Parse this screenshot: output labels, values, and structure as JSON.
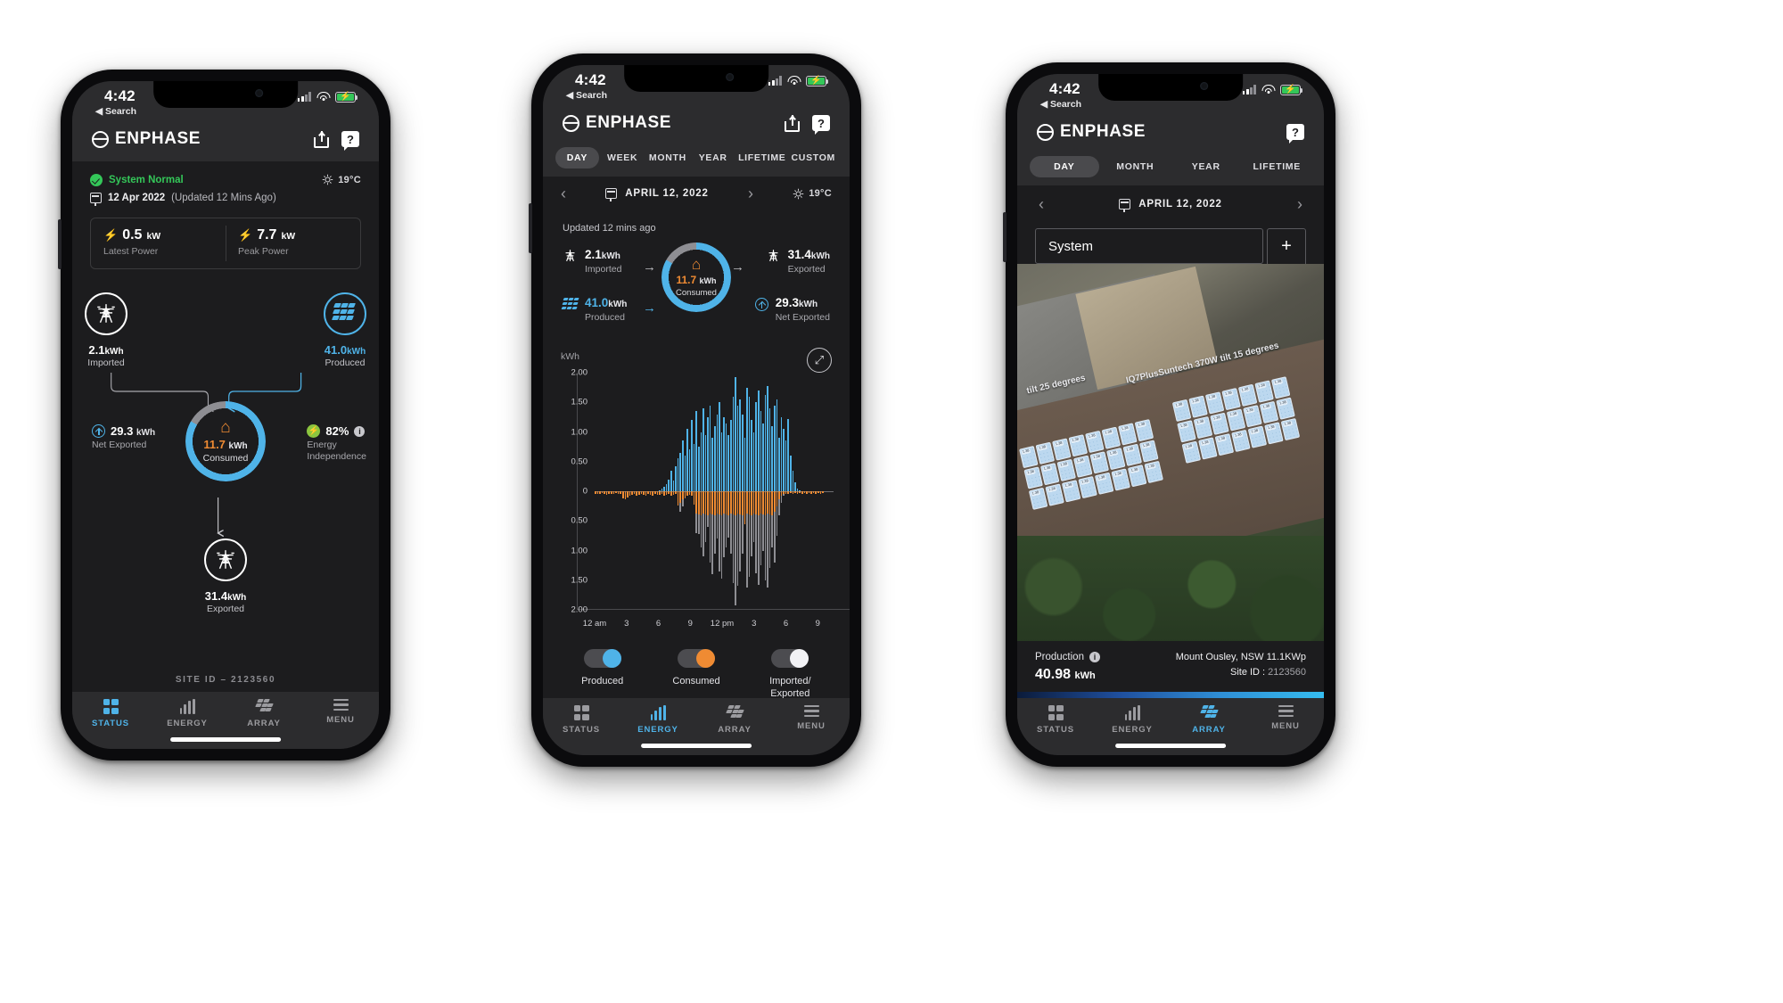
{
  "common": {
    "status_time": "4:42",
    "back_label": "◀ Search",
    "brand": "ENPHASE",
    "help_glyph": "?",
    "nav": [
      {
        "label": "STATUS",
        "icon": "status-grid-icon"
      },
      {
        "label": "ENERGY",
        "icon": "energy-bars-icon"
      },
      {
        "label": "ARRAY",
        "icon": "array-panels-icon"
      },
      {
        "label": "MENU",
        "icon": "hamburger-icon"
      }
    ],
    "colors": {
      "accent_blue": "#4fb3e8",
      "consumed_orange": "#ef8b33",
      "ok_green": "#34c759",
      "eco_green": "#8bc53f",
      "grey_series": "#8e8e93"
    }
  },
  "phone1": {
    "active_tab": "STATUS",
    "system_status": "System Normal",
    "date": "12 Apr 2022",
    "updated": "(Updated 12 Mins Ago)",
    "temperature": "19°C",
    "power": [
      {
        "value": "0.5",
        "unit": "kW",
        "label": "Latest Power"
      },
      {
        "value": "7.7",
        "unit": "kW",
        "label": "Peak Power"
      }
    ],
    "flow": {
      "imported": {
        "value": "2.1",
        "unit": "kWh",
        "label": "Imported"
      },
      "produced": {
        "value": "41.0",
        "unit": "kWh",
        "label": "Produced"
      },
      "consumed": {
        "value": "11.7",
        "unit": "kWh",
        "label": "Consumed"
      },
      "exported": {
        "value": "31.4",
        "unit": "kWh",
        "label": "Exported"
      },
      "net_exported": {
        "value": "29.3",
        "unit": "kWh",
        "label": "Net Exported"
      },
      "energy_independence": {
        "value": "82%",
        "label": "Energy\nIndependence"
      }
    },
    "site_id": "SITE ID – 2123560"
  },
  "phone2": {
    "active_tab": "ENERGY",
    "tabs": [
      "DAY",
      "WEEK",
      "MONTH",
      "YEAR",
      "LIFETIME",
      "CUSTOM"
    ],
    "active_range": "DAY",
    "date": "APRIL 12, 2022",
    "temperature": "19°C",
    "updated": "Updated 12 mins ago",
    "summary": {
      "imported": {
        "value": "2.1",
        "unit": "kWh",
        "label": "Imported"
      },
      "produced": {
        "value": "41.0",
        "unit": "kWh",
        "label": "Produced"
      },
      "consumed": {
        "value": "11.7",
        "unit": "kWh",
        "label": "Consumed"
      },
      "exported": {
        "value": "31.4",
        "unit": "kWh",
        "label": "Exported"
      },
      "net_exported": {
        "value": "29.3",
        "unit": "kWh",
        "label": "Net Exported"
      }
    },
    "legend": [
      {
        "label": "Produced",
        "color": "#4fb3e8",
        "on": true
      },
      {
        "label": "Consumed",
        "color": "#ef8b33",
        "on": true
      },
      {
        "label": "Imported/\nExported",
        "color": "#f2f2f5",
        "on": true
      }
    ],
    "chart_data": {
      "type": "bar",
      "title": "",
      "ylabel": "kWh",
      "xlabel": "",
      "grid": false,
      "legend_position": "below",
      "ylim": [
        -2.0,
        2.0
      ],
      "yticks": [
        2.0,
        1.5,
        1.0,
        0.5,
        0,
        0.5,
        1.0,
        1.5,
        2.0
      ],
      "ytick_labels": [
        "2.00",
        "1.50",
        "1.00",
        "0.50",
        "0",
        "0.50",
        "1.00",
        "1.50",
        "2.00"
      ],
      "xticks": [
        0,
        3,
        6,
        9,
        12,
        15,
        18,
        21
      ],
      "xtick_labels": [
        "12 am",
        "3",
        "6",
        "9",
        "12 pm",
        "3",
        "6",
        "9"
      ],
      "interval_minutes": 15,
      "series": [
        {
          "name": "Produced",
          "color": "#4fb3e8",
          "direction": "positive",
          "values": [
            0,
            0,
            0,
            0,
            0,
            0,
            0,
            0,
            0,
            0,
            0,
            0,
            0,
            0,
            0,
            0,
            0,
            0,
            0,
            0,
            0,
            0,
            0,
            0,
            0,
            0,
            0,
            0,
            0.02,
            0.05,
            0.08,
            0.12,
            0.2,
            0.35,
            0.18,
            0.42,
            0.55,
            0.65,
            0.85,
            0.6,
            1.05,
            0.7,
            1.2,
            0.8,
            1.35,
            0.75,
            1.0,
            1.4,
            0.95,
            1.25,
            1.45,
            0.9,
            1.1,
            1.3,
            1.5,
            1.0,
            1.25,
            1.15,
            0.95,
            1.2,
            1.6,
            1.92,
            1.45,
            1.55,
            1.3,
            0.9,
            1.75,
            1.6,
            1.2,
            1.0,
            1.5,
            1.7,
            1.35,
            1.15,
            1.62,
            1.78,
            1.4,
            1.1,
            1.45,
            1.55,
            0.9,
            1.25,
            1.05,
            0.85,
            1.22,
            0.6,
            0.35,
            0.15,
            0.05,
            0.02,
            0,
            0,
            0,
            0,
            0,
            0,
            0,
            0,
            0,
            0,
            0,
            0,
            0,
            0
          ]
        },
        {
          "name": "Consumed",
          "color": "#ef8b33",
          "direction": "negative",
          "values": [
            0.04,
            0.05,
            0.04,
            0.03,
            0.05,
            0.06,
            0.04,
            0.05,
            0.04,
            0.03,
            0.04,
            0.05,
            0.12,
            0.14,
            0.1,
            0.08,
            0.06,
            0.05,
            0.07,
            0.06,
            0.05,
            0.06,
            0.07,
            0.05,
            0.06,
            0.07,
            0.05,
            0.06,
            0.06,
            0.05,
            0.07,
            0.06,
            0.05,
            0.07,
            0.06,
            0.05,
            0.24,
            0.2,
            0.14,
            0.1,
            0.08,
            0.06,
            0.07,
            0.22,
            0.38,
            0.39,
            0.4,
            0.38,
            0.39,
            0.4,
            0.38,
            0.39,
            0.4,
            0.38,
            0.39,
            0.4,
            0.38,
            0.39,
            0.4,
            0.38,
            0.39,
            0.4,
            0.38,
            0.39,
            0.4,
            0.55,
            0.38,
            0.39,
            0.4,
            0.38,
            0.39,
            0.4,
            0.38,
            0.39,
            0.4,
            0.38,
            0.39,
            0.4,
            0.35,
            0.25,
            0.14,
            0.08,
            0.05,
            0.04,
            0.04,
            0.03,
            0.04,
            0.03,
            0.04,
            0.03,
            0.04,
            0.03,
            0.04,
            0.03,
            0.04,
            0.03,
            0.04,
            0.03,
            0.04,
            0.03
          ]
        },
        {
          "name": "Imported/Exported",
          "color": "#8e8e93",
          "direction": "negative",
          "values": [
            0,
            0,
            0,
            0,
            0,
            0,
            0,
            0,
            0,
            0,
            0,
            0,
            0,
            0,
            0,
            0,
            0,
            0,
            0,
            0,
            0,
            0,
            0,
            0,
            0,
            0,
            0,
            0,
            0,
            0,
            0,
            0,
            0,
            0,
            0,
            0,
            0.18,
            0.35,
            0.25,
            0.12,
            0,
            0,
            0,
            0,
            0.7,
            0.72,
            0.95,
            1.1,
            0.85,
            0.6,
            1.2,
            1.4,
            1.05,
            0.8,
            1.35,
            1.48,
            1.12,
            0.95,
            0.78,
            1.05,
            1.55,
            1.92,
            1.6,
            1.35,
            1.05,
            0.55,
            1.62,
            1.45,
            1.1,
            0.85,
            1.38,
            1.58,
            1.25,
            1.0,
            1.5,
            1.62,
            1.3,
            0.95,
            1.2,
            0.75,
            0.4,
            0.2,
            0.08,
            0.03,
            0,
            0,
            0,
            0,
            0,
            0,
            0,
            0,
            0,
            0,
            0,
            0,
            0,
            0,
            0,
            0
          ]
        }
      ]
    }
  },
  "phone3": {
    "active_tab": "ARRAY",
    "tabs": [
      "DAY",
      "MONTH",
      "YEAR",
      "LIFETIME"
    ],
    "active_range": "DAY",
    "date": "APRIL 12, 2022",
    "system_select": "System",
    "zoom_in": "+",
    "zoom_out": "−",
    "array_label": "IQ7PlusSuntech 370W tilt 15 degrees",
    "array_label2": "tilt 25 degrees",
    "panel_value": "1.38",
    "production_label": "Production",
    "production_value": "40.98",
    "production_unit": "kWh",
    "location": "Mount Ousley, NSW 11.1KWp",
    "site_id_label": "Site ID :",
    "site_id": "2123560"
  }
}
